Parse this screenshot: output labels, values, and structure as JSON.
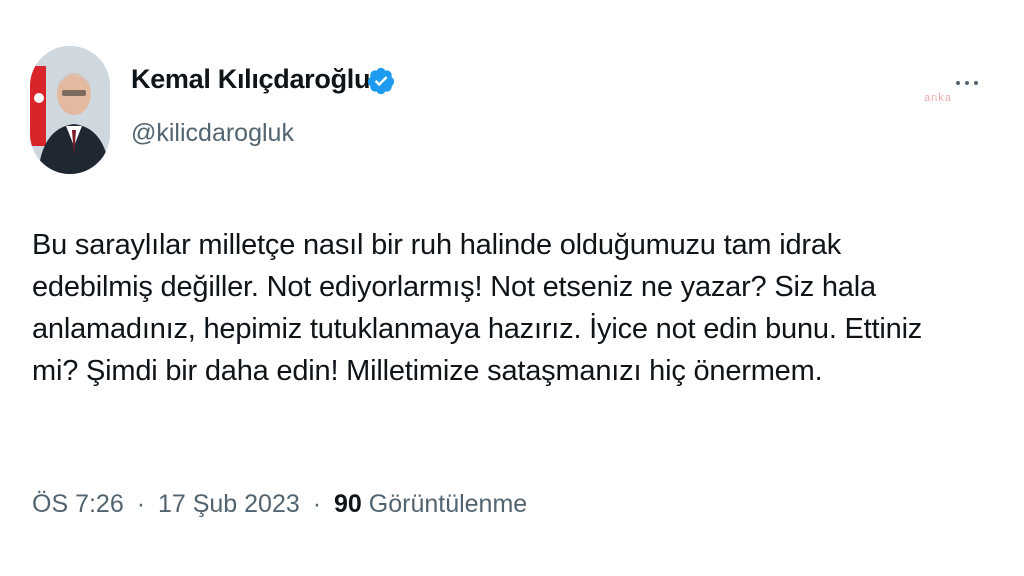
{
  "author": {
    "name": "Kemal Kılıçdaroğlu",
    "handle": "@kilicdarogluk",
    "verified": true
  },
  "tweet": {
    "text": "Bu saraylılar milletçe nasıl bir ruh halinde olduğumuzu tam idrak\nedebilmiş değiller. Not ediyorlarmış! Not etseniz ne yazar? Siz hala\nanlamadınız, hepimiz tutuklanmaya hazırız. İyice not edin bunu. Ettiniz\nmi? Şimdi bir daha edin! Milletimize sataşmanızı hiç önermem."
  },
  "meta": {
    "time": "ÖS 7:26",
    "separator": "·",
    "date": "17 Şub 2023",
    "views_count": "90",
    "views_label": "Görüntülenme"
  },
  "watermark": "anka",
  "colors": {
    "text": "#0f1419",
    "secondary": "#536471",
    "verified_badge": "#1d9bf0"
  },
  "icons": {
    "verified": "verified-badge-icon",
    "more": "more-options-icon"
  }
}
